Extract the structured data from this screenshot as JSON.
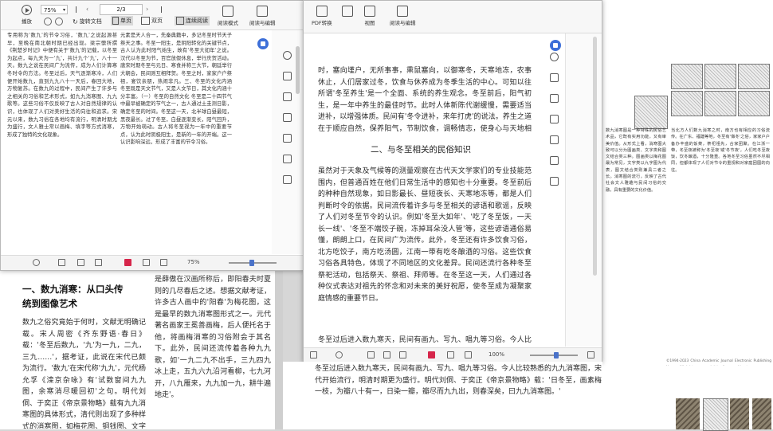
{
  "win_left": {
    "zoom_value": "75%",
    "page_current": "2",
    "page_total": "/3",
    "toolbar": {
      "rotate_label": "旋转文档",
      "single_label": "单页",
      "double_label": "双页",
      "continuous_label": "连续阅读",
      "read_mode_label": "阅读模式",
      "read_edit_label": "阅读与编辑",
      "play_label": "播放"
    },
    "status_zoom": "75%",
    "page_text_col1": "专用称为'数九'的节令习俗，'数九'之说起源甚早，至晚在南北朝时期已经出现。梁宗懔所撰《荆楚岁时记》中便有关于'数九'的记载，以冬至为起点，每九天为一'九'，共计九个'九'，八十一天。数九之说在民间广为流传，成为人们计算寒冬时令的方法。冬至过后，天气逐渐寒冷，人们便开始数九，直到九九八十一天后，春回大地，万物复苏。在数九的过程中，民间产生了许多与之相关的习俗和艺术形式，如九九消寒图、九九歌等。这些习俗不仅反映了古人对自然规律的认识，也体现了人们对美好生活的向往和追求。宋元以来，数九习俗在各地均有流行，明清时期尤为盛行，文人雅士常以画梅、填字等方式消寒，形成了独特的文化现象。",
    "page_text_col2": "元素是天人合一，先秦典籍中，多记冬至时节天子祭天之事。冬至一阳生，是阴阳转化的关键节点，古人认为此时阳气始生，故有'冬至大如年'之说。汉代以冬至为节，百官放假休息，举行庆贺活动。唐宋时期冬至与元日、寒食并称三大节，朝廷举行大朝会，民间则互相拜贺。冬至之时，家家户户祭祖，宴饮亲朋，热闹非凡。三、冬至的文化内涵 冬至既是天文节气，又是人文节日，其文化内涵十分丰富。（一）冬至的自然文化 冬至是二十四节气中最早被确定的节气之一，古人通过土圭测日影，确定冬至的时间。冬至这一天，北半球白昼最短，黑夜最长。过了冬至，白昼逐渐变长，阳气回升，万物开始萌动。古人将冬至视为一年中的重要节点，认为此时阴极阳生，是新的一年的开端。这一认识影响深远，形成了丰富的节令习俗。"
  },
  "win_right": {
    "toolbar": {
      "pdf_convert_label": "PDF转换",
      "view_label": "视图",
      "read_edit_label": "阅读与编辑"
    },
    "status_zoom": "100%",
    "para1": "时，塞向墐户，无所事事，熏鼠塞向，以御寒冬，天寒地冻，农事休止，人们居家过冬，饮食与休养成为冬季生活的中心。可知以往所谓'冬至养生'是一个全面、系统的养生观念。冬至前后，阳气初生，是一年中养生的最佳时节。此时人体新陈代谢缓慢，需要适当进补，以增强体质。民间有'冬令进补，来年打虎'的说法。养生之道在于顺应自然，保养阳气，节制饮食，调畅情志，使身心与天地相合。",
    "section_title": "二、与冬至相关的民俗知识",
    "para2": "虽然对于天象及气候等的测量观察在古代天文学家们的专业技能范围内，但普通百姓在他们日常生活中的感知也十分重要。冬至前后的种种自然现象，如日影最长、昼短夜长、天寒地冻等，都是人们判断时令的依据。民间流传着许多与冬至相关的谚语和歌谣，反映了人们对冬至节令的认识。例如'冬至大如年'、'吃了冬至饭，一天长一线'、'冬至不端饺子碗，冻掉耳朵没人管'等，这些谚语通俗易懂，朗朗上口，在民间广为流传。此外，冬至还有许多饮食习俗，北方吃饺子，南方吃汤圆，江南一带有吃冬酿酒的习俗。这些饮食习俗各具特色，体现了不同地区的文化差异。民间还流行各种冬至祭祀活动，包括祭天、祭祖、拜师等。在冬至这一天，人们通过各种仪式表达对祖先的怀念和对未来的美好祝愿，使冬至成为凝聚家庭情感的重要节日。",
    "para3": "冬至过后进入数九寒天，民间有画九、写九、唱九等习俗。今人比较熟悉的九九消寒图，宋代开始流行，明清时期更为盛行。明代刘侗、于奕正《帝京景物略》载：'日冬至，画素梅一枝，为瓣八十有一，日染一瓣，瓣尽而九九出，则春深矣，曰九九消寒图。'"
  },
  "page_bottom_left": {
    "heading": "一、数九消寒：从口头传统到图像艺术",
    "col1": "数九之俗究竟始于何时，文献无明确记载。宋人周密《齐东野语·春日》载：'冬至后数九，'九'为一九，二九，三九……'，据考证，此说在宋代已颇为流行。'数九'在宋代称'九九'，元代杨允孚《滦京杂咏》有'试数窗间九九图，余寒消尽暖回初'之句。明代刘侗、于奕正《帝京景物略》载有九九消寒图的具体形式，清代则出现了多种样式的消寒图，如梅花图、铜钱图、文字图等，其中以'亭前垂柳珍重待春风'九字最为著名。",
    "col2": "是薛傲在汉画所称后，即阳春夫时夏则的几尽春后之述。想据文献考证，许多古人画中的'阳春'为梅花图，这是最早的数九消寒图形式之一。元代著名画家王冕善画梅，后人便托名于他，将画梅消寒的习俗附会于其名下。此外，民间还流传着各种九九歌，如'一九二九不出手，三九四九冰上走，五九六九沿河看柳，七九河开，八九雁来，九九加一九，耕牛遍地走'。"
  },
  "right_page": {
    "col_a": "当北方人们数九消寒之时，南方也有相应的习俗流传。在广东、福建等地，冬至有'做冬'之俗，家家户户备办丰盛的饭菜，祭祀祖先，合家团聚。在江浙一带，冬至夜被称为'冬至夜'或'冬节夜'，人们吃冬至夜饭，饮冬酿酒，十分隆重。各地冬至习俗虽然不尽相同，但都体现了人们对节令的重视和对家庭团圆的向往。",
    "col_b": "数九消寒图是一种特殊的民俗艺术品，它既有实用功能，又有审美价值。从形式上看，消寒图大致可以分为图画类、文字类和图文结合类三种。图画类以梅花图最为常见，文字类以九字图为代表，图文结合类则兼具二者之长。消寒图的流行，反映了古代社会文人雅趣与民间习俗的交融，具有重要的文化价值。",
    "footer": "©1994-2023 China Academic Journal Electronic Publishing House. All rights reserved.   http://www.cnki.net"
  }
}
